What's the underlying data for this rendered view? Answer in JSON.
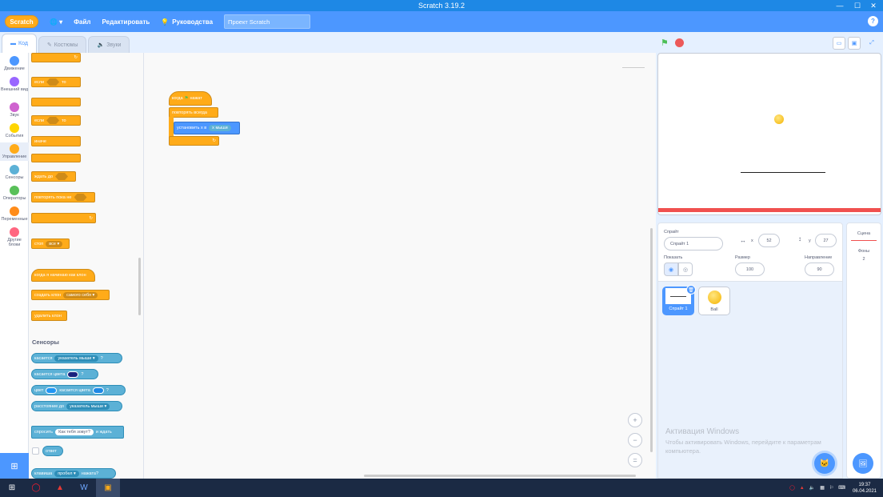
{
  "window": {
    "title": "Scratch 3.19.2",
    "minimize": "—",
    "maximize": "☐",
    "close": "✕"
  },
  "menu": {
    "logo": "Scratch",
    "globe": "🌐 ▾",
    "file": "Файл",
    "edit": "Редактировать",
    "tutorials": "Руководства",
    "project_title": "Проект Scratch",
    "help": "?"
  },
  "tabs": {
    "code": "Код",
    "costumes": "Костюмы",
    "sounds": "Звуки"
  },
  "categories": [
    {
      "label": "Движение",
      "color": "#4c97ff"
    },
    {
      "label": "Внешний вид",
      "color": "#9966ff"
    },
    {
      "label": "Звук",
      "color": "#cf63cf"
    },
    {
      "label": "События",
      "color": "#ffd500"
    },
    {
      "label": "Управление",
      "color": "#ffab19"
    },
    {
      "label": "Сенсоры",
      "color": "#5cb1d6"
    },
    {
      "label": "Операторы",
      "color": "#59c059"
    },
    {
      "label": "Переменные",
      "color": "#ff8c1a"
    },
    {
      "label": "Другие блоки",
      "color": "#ff6680"
    }
  ],
  "palette": {
    "if1": "если",
    "then1": "то",
    "if2": "если",
    "then2": "то",
    "else": "иначе",
    "wait_until": "ждать до",
    "repeat_until": "повторять пока не",
    "stop": "стоп",
    "stop_opt": "все ▾",
    "clone_start": "когда я начинаю как клон",
    "create_clone": "создать клон",
    "create_clone_opt": "самого себя ▾",
    "delete_clone": "удалить клон",
    "sensing_title": "Сенсоры",
    "touching": "касается",
    "touching_opt": "указатель мыши ▾",
    "q1": "?",
    "touching_color": "касается цвета",
    "q2": "?",
    "color_word": "цвет",
    "color_touching": "касается цвета",
    "q3": "?",
    "distance": "расстояние до",
    "distance_opt": "указатель мыши ▾",
    "ask": "спросить",
    "ask_text": "Как тебя зовут?",
    "ask_wait": "и ждать",
    "answer": "ответ",
    "key_pressed": "клавиша",
    "key_opt": "пробел ▾",
    "key_q": "нажата?"
  },
  "script": {
    "hat": "когда",
    "hat2": "нажат",
    "forever": "повторять всегда",
    "set_x": "установить x в",
    "mouse_x": "x мыши"
  },
  "zoom": {
    "in": "+",
    "out": "−",
    "reset": "="
  },
  "sprite_info": {
    "sprite_label": "Спрайт",
    "sprite_name": "Спрайт 1",
    "x_label": "x",
    "x_value": "52",
    "y_label": "y",
    "y_value": "27",
    "show_label": "Показать",
    "size_label": "Размер",
    "size_value": "100",
    "direction_label": "Направление",
    "direction_value": "90"
  },
  "sprites": [
    {
      "name": "Спрайт 1"
    },
    {
      "name": "Ball"
    }
  ],
  "stage_panel": {
    "title": "Сцена",
    "backdrops_label": "Фоны",
    "backdrops_count": "2"
  },
  "watermark": {
    "title": "Активация Windows",
    "line1": "Чтобы активировать Windows, перейдите к параметрам",
    "line2": "компьютера."
  },
  "taskbar": {
    "time": "19:37",
    "date": "06.04.2021"
  }
}
